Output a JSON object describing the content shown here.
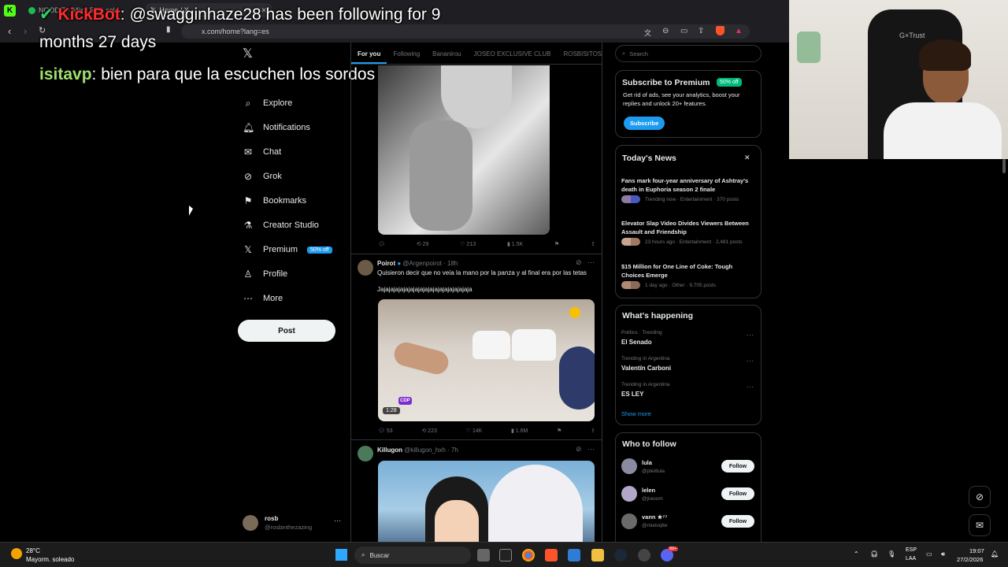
{
  "browser": {
    "tabs": [
      {
        "label": "NOODIT · Mix · 55% sold"
      },
      {
        "label": "Home / X"
      }
    ],
    "url": "x.com/home?lang=es"
  },
  "chat_overlay": {
    "line1_user": "KickBot",
    "line1_text": ": @swagginhaze28 has been following for 9",
    "line2_text": "months 27 days",
    "line3_user": "isitavp",
    "line3_text": ": bien para que la escuchen los sordos"
  },
  "sidebar": {
    "items": [
      {
        "label": "Explore",
        "icon": "search-icon"
      },
      {
        "label": "Notifications",
        "icon": "bell-icon"
      },
      {
        "label": "Chat",
        "icon": "mail-icon"
      },
      {
        "label": "Grok",
        "icon": "grok-icon"
      },
      {
        "label": "Bookmarks",
        "icon": "bookmark-icon"
      },
      {
        "label": "Creator Studio",
        "icon": "flask-icon"
      },
      {
        "label": "Premium",
        "icon": "x-icon"
      },
      {
        "label": "Profile",
        "icon": "person-icon"
      },
      {
        "label": "More",
        "icon": "more-circle-icon"
      }
    ],
    "premium_badge": "50% off",
    "post_label": "Post",
    "account": {
      "name": "rosb",
      "handle": "@rosbinthezazing"
    }
  },
  "feed": {
    "tabs": [
      "For you",
      "Following",
      "Bananirou",
      "JOSEO EXCLUSIVE CLUB",
      "ROSBISITOS"
    ],
    "tweets": [
      {
        "actions": {
          "replies": "",
          "retweets": "29",
          "likes": "213",
          "views": "1.5K"
        }
      },
      {
        "name": "Poirot",
        "handle": "@Argenpoirot",
        "time": "· 18h",
        "text1": "Quisieron decir que no veía la mano por la panza y al final era por las tetas",
        "text2": "Jajajajajajajajajajajajajajajajajajaja",
        "video_time": "1:28",
        "video_logo": "CDP",
        "actions": {
          "replies": "53",
          "retweets": "223",
          "likes": "14K",
          "views": "1.6M"
        }
      },
      {
        "name": "Killugon",
        "handle": "@killugon_hxh",
        "time": "· 7h"
      }
    ]
  },
  "right": {
    "search_placeholder": "Search",
    "premium": {
      "title": "Subscribe to Premium",
      "badge": "50% off",
      "text": "Get rid of ads, see your analytics, boost your replies and unlock 20+ features.",
      "button": "Subscribe"
    },
    "news": {
      "title": "Today's News",
      "items": [
        {
          "title": "Fans mark four-year anniversary of Ashtray's death in Euphoria season 2 finale",
          "meta": "Trending now · Entertainment · 370 posts"
        },
        {
          "title": "Elevator Slap Video Divides Viewers Between Assault and Friendship",
          "meta": "23 hours ago · Entertainment · 2,481 posts"
        },
        {
          "title": "$15 Million for One Line of Coke: Tough Choices Emerge",
          "meta": "1 day ago · Other · 9,705 posts"
        }
      ]
    },
    "happening": {
      "title": "What's happening",
      "items": [
        {
          "context": "Politics · Trending",
          "topic": "El Senado"
        },
        {
          "context": "Trending in Argentina",
          "topic": "Valentín Carboni"
        },
        {
          "context": "Trending in Argentina",
          "topic": "ES LEY"
        }
      ],
      "show_more": "Show more"
    },
    "follow": {
      "title": "Who to follow",
      "items": [
        {
          "name": "lula",
          "handle": "@pteitlula"
        },
        {
          "name": "lelen",
          "handle": "@jiwoom"
        },
        {
          "name": "vann ★⁷⁷",
          "handle": "@mielvqtte"
        }
      ],
      "button": "Follow"
    }
  },
  "webcam": {
    "chair_brand": "G×Trust"
  },
  "taskbar": {
    "weather_temp": "28°C",
    "weather_desc": "Mayorm. soleado",
    "search": "Buscar",
    "lang1": "ESP",
    "lang2": "LAA",
    "time": "19:07",
    "date": "27/2/2026",
    "notif_count": "99+"
  }
}
